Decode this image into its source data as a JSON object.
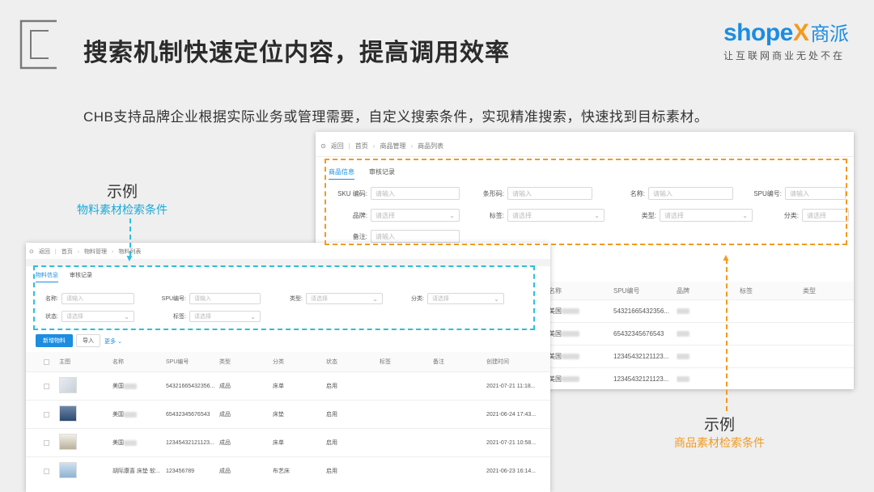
{
  "title": "搜索机制快速定位内容，提高调用效率",
  "brand": {
    "name_a": "shope",
    "name_x": "X",
    "name_cn": "商派",
    "slogan": "让互联网商业无处不在"
  },
  "description": "CHB支持品牌企业根据实际业务或管理需要，自定义搜索条件，实现精准搜索，快速找到目标素材。",
  "annotations": {
    "left": {
      "example": "示例",
      "caption": "物料素材检索条件"
    },
    "right": {
      "example": "示例",
      "caption": "商品素材检索条件"
    }
  },
  "colors": {
    "orange": "#f39a1e",
    "cyan": "#2cbfdc",
    "blue": "#1c8de0"
  },
  "product_panel": {
    "back": "返回",
    "crumbs": [
      "首页",
      "商品管理",
      "商品列表"
    ],
    "tabs": [
      "商品信息",
      "审核记录"
    ],
    "fields": [
      {
        "label": "SKU 编码:",
        "placeholder": "请输入"
      },
      {
        "label": "条形码:",
        "placeholder": "请输入"
      },
      {
        "label": "名称:",
        "placeholder": "请输入"
      },
      {
        "label": "SPU编号:",
        "placeholder": "请输入"
      },
      {
        "label": "品牌:",
        "placeholder": "请选择"
      },
      {
        "label": "标签:",
        "placeholder": "请选择"
      },
      {
        "label": "类型:",
        "placeholder": "请选择"
      },
      {
        "label": "分类:",
        "placeholder": "请选择"
      },
      {
        "label": "备注:",
        "placeholder": "请输入"
      }
    ],
    "columns": [
      "名称",
      "SPU编号",
      "品牌",
      "标签",
      "类型"
    ],
    "rows": [
      {
        "name": "美国",
        "spu": "54321665432356..."
      },
      {
        "name": "美国",
        "spu": "65432345676543"
      },
      {
        "name": "美国",
        "spu": "12345432121123..."
      },
      {
        "name": "美国",
        "spu": "12345432121123..."
      }
    ]
  },
  "material_panel": {
    "back": "返回",
    "crumbs": [
      "首页",
      "物料管理",
      "物料列表"
    ],
    "tabs": [
      "物料信息",
      "审核记录"
    ],
    "fields": [
      {
        "label": "名称:",
        "placeholder": "请输入"
      },
      {
        "label": "SPU编号:",
        "placeholder": "请输入"
      },
      {
        "label": "类型:",
        "placeholder": "请选择"
      },
      {
        "label": "分类:",
        "placeholder": "请选择"
      },
      {
        "label": "状态:",
        "placeholder": "请选择"
      },
      {
        "label": "标签:",
        "placeholder": "请选择"
      }
    ],
    "buttons": {
      "new": "新增物料",
      "import": "导入",
      "more": "更多"
    },
    "columns": [
      "主图",
      "名称",
      "SPU编号",
      "类型",
      "分类",
      "状态",
      "标签",
      "备注",
      "创建时间"
    ],
    "rows": [
      {
        "name": "美国",
        "spu": "54321665432356...",
        "type": "成品",
        "category": "床单",
        "status": "启用",
        "created": "2021-07-21 11:18..."
      },
      {
        "name": "美国",
        "spu": "65432345676543",
        "type": "成品",
        "category": "床垫",
        "status": "启用",
        "created": "2021-06-24 17:43..."
      },
      {
        "name": "美国",
        "spu": "12345432121123...",
        "type": "成品",
        "category": "床单",
        "status": "启用",
        "created": "2021-07-21 10:58..."
      },
      {
        "name": "胡际康喜 床垫 软...",
        "spu": "123456789",
        "type": "成品",
        "category": "布艺床",
        "status": "启用",
        "created": "2021-06-23 16:14..."
      }
    ]
  }
}
